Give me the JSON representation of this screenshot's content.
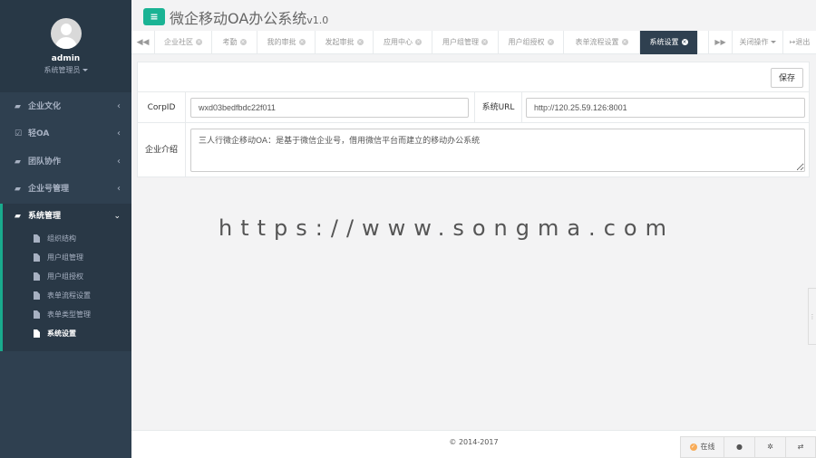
{
  "profile": {
    "name": "admin",
    "role": "系统管理员"
  },
  "sidebar": {
    "items": [
      {
        "label": "企业文化"
      },
      {
        "label": "轻OA"
      },
      {
        "label": "团队协作"
      },
      {
        "label": "企业号管理"
      }
    ],
    "open": {
      "label": "系统管理",
      "children": [
        {
          "label": "组织结构"
        },
        {
          "label": "用户组管理"
        },
        {
          "label": "用户组授权"
        },
        {
          "label": "表单流程设置"
        },
        {
          "label": "表单类型管理"
        },
        {
          "label": "系统设置"
        }
      ]
    }
  },
  "header": {
    "title": "微企移动OA办公系统",
    "version": "v1.0"
  },
  "tabs": [
    {
      "label": "企业社区"
    },
    {
      "label": "考勤"
    },
    {
      "label": "我的审批"
    },
    {
      "label": "发起审批"
    },
    {
      "label": "应用中心"
    },
    {
      "label": "用户组管理"
    },
    {
      "label": "用户组授权"
    },
    {
      "label": "表单流程设置"
    },
    {
      "label": "系统设置"
    }
  ],
  "tab_actions": {
    "close_ops": "关闭操作",
    "logout": "退出"
  },
  "form": {
    "save_label": "保存",
    "corpid_label": "CorpID",
    "corpid_value": "wxd03bedfbdc22f011",
    "url_label": "系统URL",
    "url_value": "http://120.25.59.126:8001",
    "intro_label": "企业介绍",
    "intro_value": "三人行微企移动OA：是基于微信企业号，借用微信平台而建立的移动办公系统"
  },
  "watermark": "https://www.songma.com",
  "footer": {
    "copyright": "© 2014-2017"
  },
  "dock": {
    "online": "在线"
  },
  "colors": {
    "accent": "#1ab394",
    "sidebar": "#2f4050",
    "warning": "#f8ac59"
  }
}
